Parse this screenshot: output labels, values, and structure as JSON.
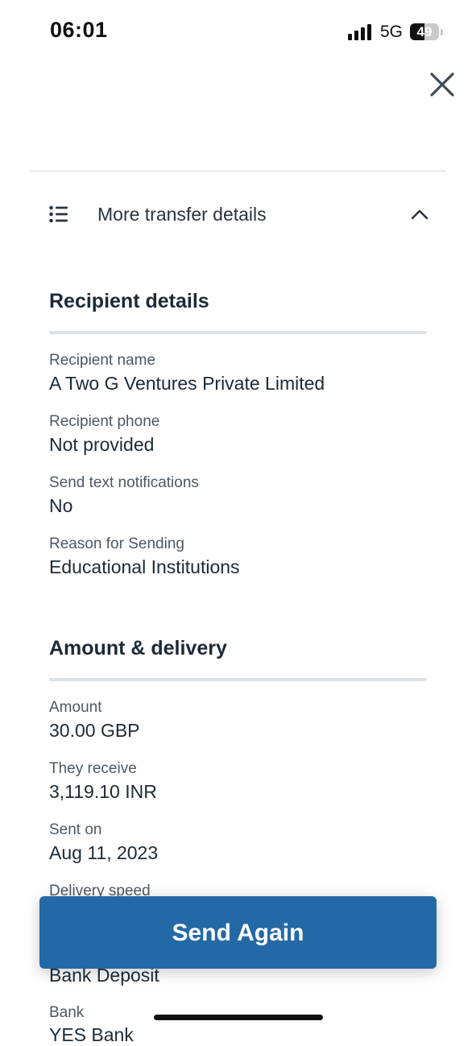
{
  "status_bar": {
    "time": "06:01",
    "network": "5G",
    "battery": "49"
  },
  "header": {
    "close_icon": "close-icon"
  },
  "more_details": {
    "label": "More transfer details",
    "icon": "list-icon",
    "toggle_icon": "chevron-up-icon"
  },
  "recipient": {
    "title": "Recipient details",
    "fields": [
      {
        "label": "Recipient name",
        "value": "A Two G Ventures Private Limited"
      },
      {
        "label": "Recipient phone",
        "value": "Not provided"
      },
      {
        "label": "Send text notifications",
        "value": "No"
      },
      {
        "label": "Reason for Sending",
        "value": "Educational Institutions"
      }
    ]
  },
  "amount_delivery": {
    "title": "Amount & delivery",
    "fields": [
      {
        "label": "Amount",
        "value": "30.00 GBP"
      },
      {
        "label": "They receive",
        "value": "3,119.10 INR"
      },
      {
        "label": "Sent on",
        "value": "Aug 11, 2023"
      },
      {
        "label": "Delivery speed",
        "value": ""
      },
      {
        "label": "",
        "value": "Bank Deposit"
      },
      {
        "label": "Bank",
        "value": "YES Bank"
      }
    ]
  },
  "actions": {
    "send_again_label": "Send Again"
  },
  "colors": {
    "primary_button": "#2369a6",
    "text_dark": "#1d2a36",
    "text_label": "#4d5864",
    "divider": "#dde2e8"
  }
}
